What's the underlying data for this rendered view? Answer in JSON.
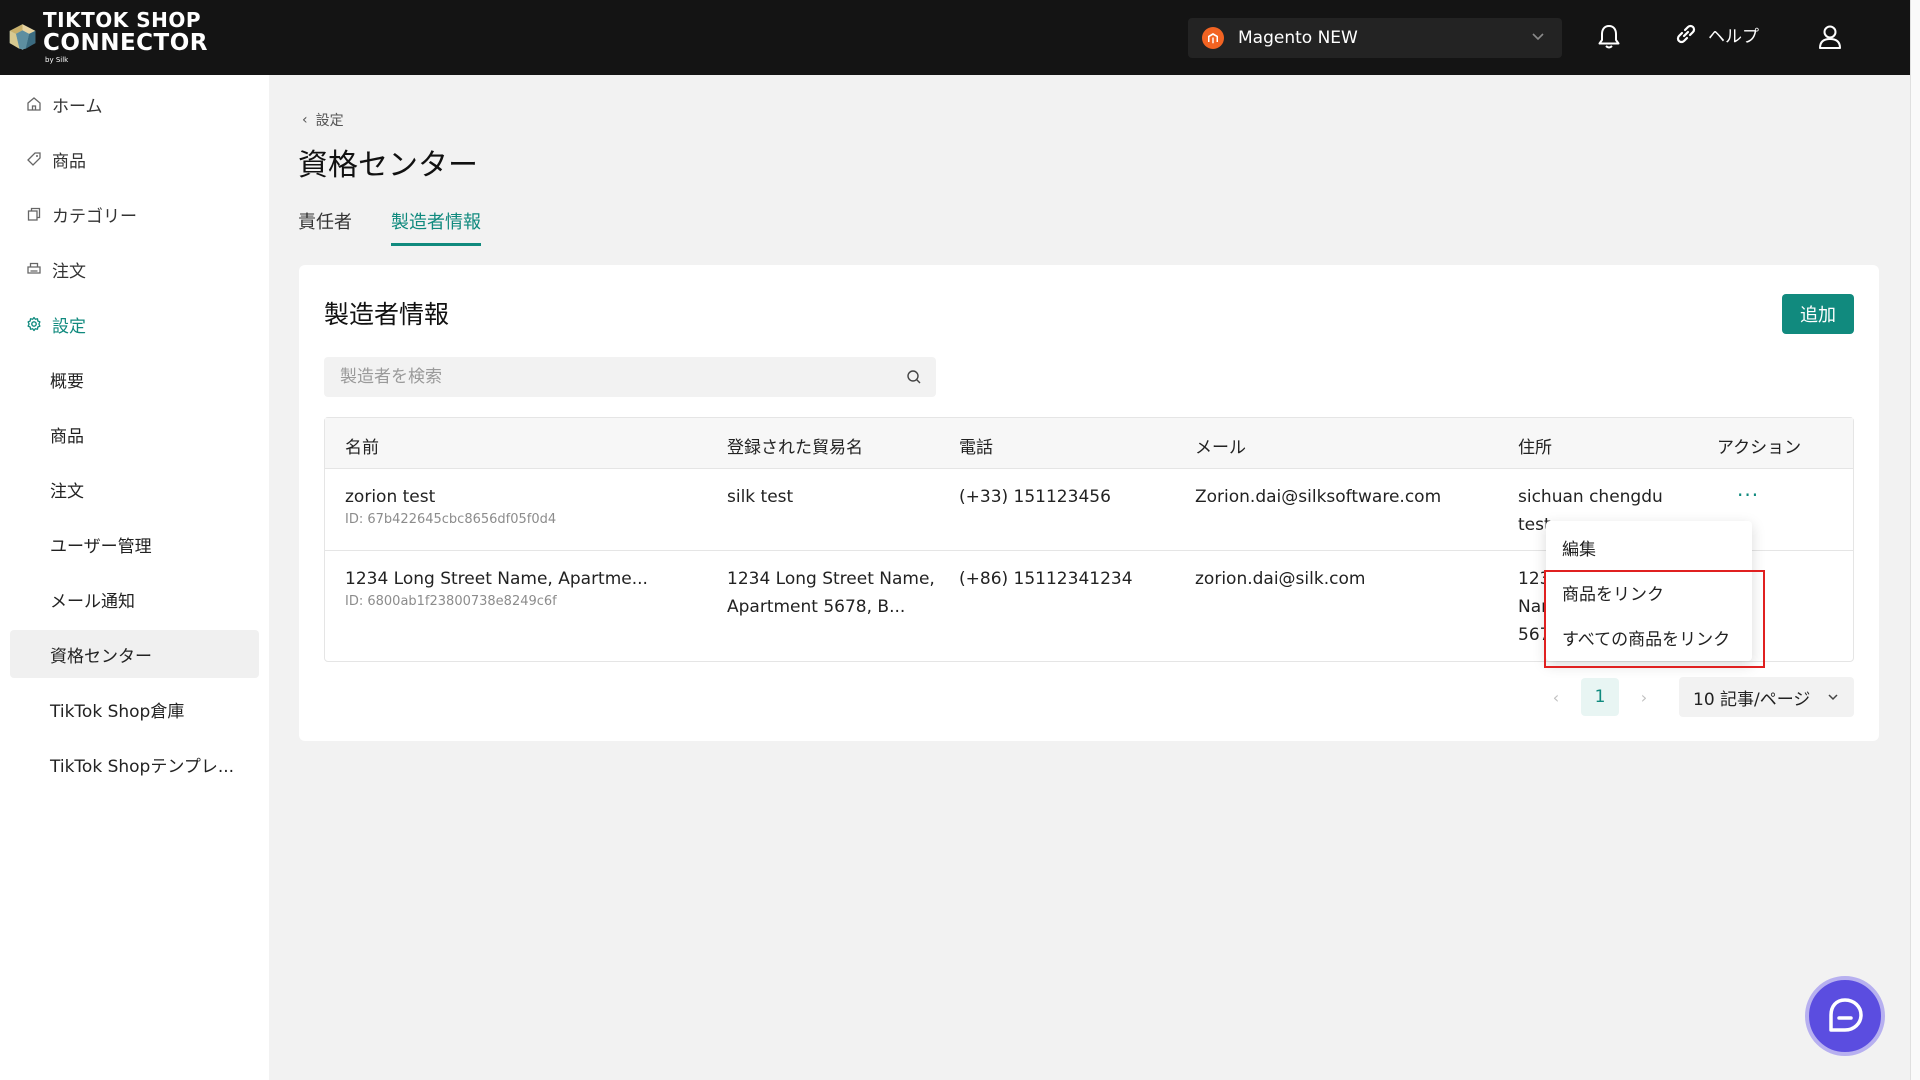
{
  "header": {
    "logo_line1": "TIKTOK SHOP",
    "logo_line2": "CONNECTOR",
    "logo_line3": "by Silk",
    "store_name": "Magento NEW",
    "help_label": "ヘルプ",
    "icons": [
      "tiktok-connector-logo",
      "magento-icon",
      "chevron-down-icon",
      "bell-icon",
      "link-icon",
      "user-icon"
    ]
  },
  "sidebar": {
    "items": [
      {
        "label": "ホーム",
        "icon": "home-icon"
      },
      {
        "label": "商品",
        "icon": "tag-icon"
      },
      {
        "label": "カテゴリー",
        "icon": "copy-icon"
      },
      {
        "label": "注文",
        "icon": "printer-icon"
      },
      {
        "label": "設定",
        "icon": "gear-icon"
      }
    ],
    "sub_items": [
      {
        "label": "概要"
      },
      {
        "label": "商品"
      },
      {
        "label": "注文"
      },
      {
        "label": "ユーザー管理"
      },
      {
        "label": "メール通知"
      },
      {
        "label": "資格センター"
      },
      {
        "label": "TikTok Shop倉庫"
      },
      {
        "label": "TikTok Shopテンプレ..."
      }
    ]
  },
  "breadcrumb": {
    "back_label": "設定"
  },
  "page": {
    "title": "資格センター"
  },
  "tabs": [
    {
      "label": "責任者"
    },
    {
      "label": "製造者情報"
    }
  ],
  "card": {
    "title": "製造者情報",
    "add_label": "追加",
    "search_placeholder": "製造者を検索"
  },
  "table": {
    "columns": [
      "名前",
      "登録された貿易名",
      "電話",
      "メール",
      "住所",
      "アクション"
    ],
    "rows": [
      {
        "name": "zorion test",
        "id": "ID: 67b422645cbc8656df05f0d4",
        "trade_name_1": "silk test",
        "trade_name_2": "",
        "phone": "(+33) 151123456",
        "email": "Zorion.dai@silksoftware.com",
        "address_1": "sichuan chengdu",
        "address_2": "test",
        "address_3": "",
        "action": "···"
      },
      {
        "name": "1234 Long Street Name, Apartme...",
        "id": "ID: 6800ab1f23800738e8249c6f",
        "trade_name_1": "1234 Long Street Name,",
        "trade_name_2": "Apartment 5678, B...",
        "phone": "(+86) 15112341234",
        "email": "zorion.dai@silk.com",
        "address_1": "123",
        "address_2": "Nar",
        "address_3": "567",
        "action": ""
      }
    ]
  },
  "dropdown": {
    "items": [
      "編集",
      "商品をリンク",
      "すべての商品をリンク"
    ]
  },
  "pagination": {
    "prev": "‹",
    "current": "1",
    "next": "›",
    "page_size": "10 記事/ページ"
  },
  "colors": {
    "accent": "#108a7e",
    "header_bg": "#141414",
    "highlight": "#e02020",
    "chat": "#5b4de0"
  }
}
